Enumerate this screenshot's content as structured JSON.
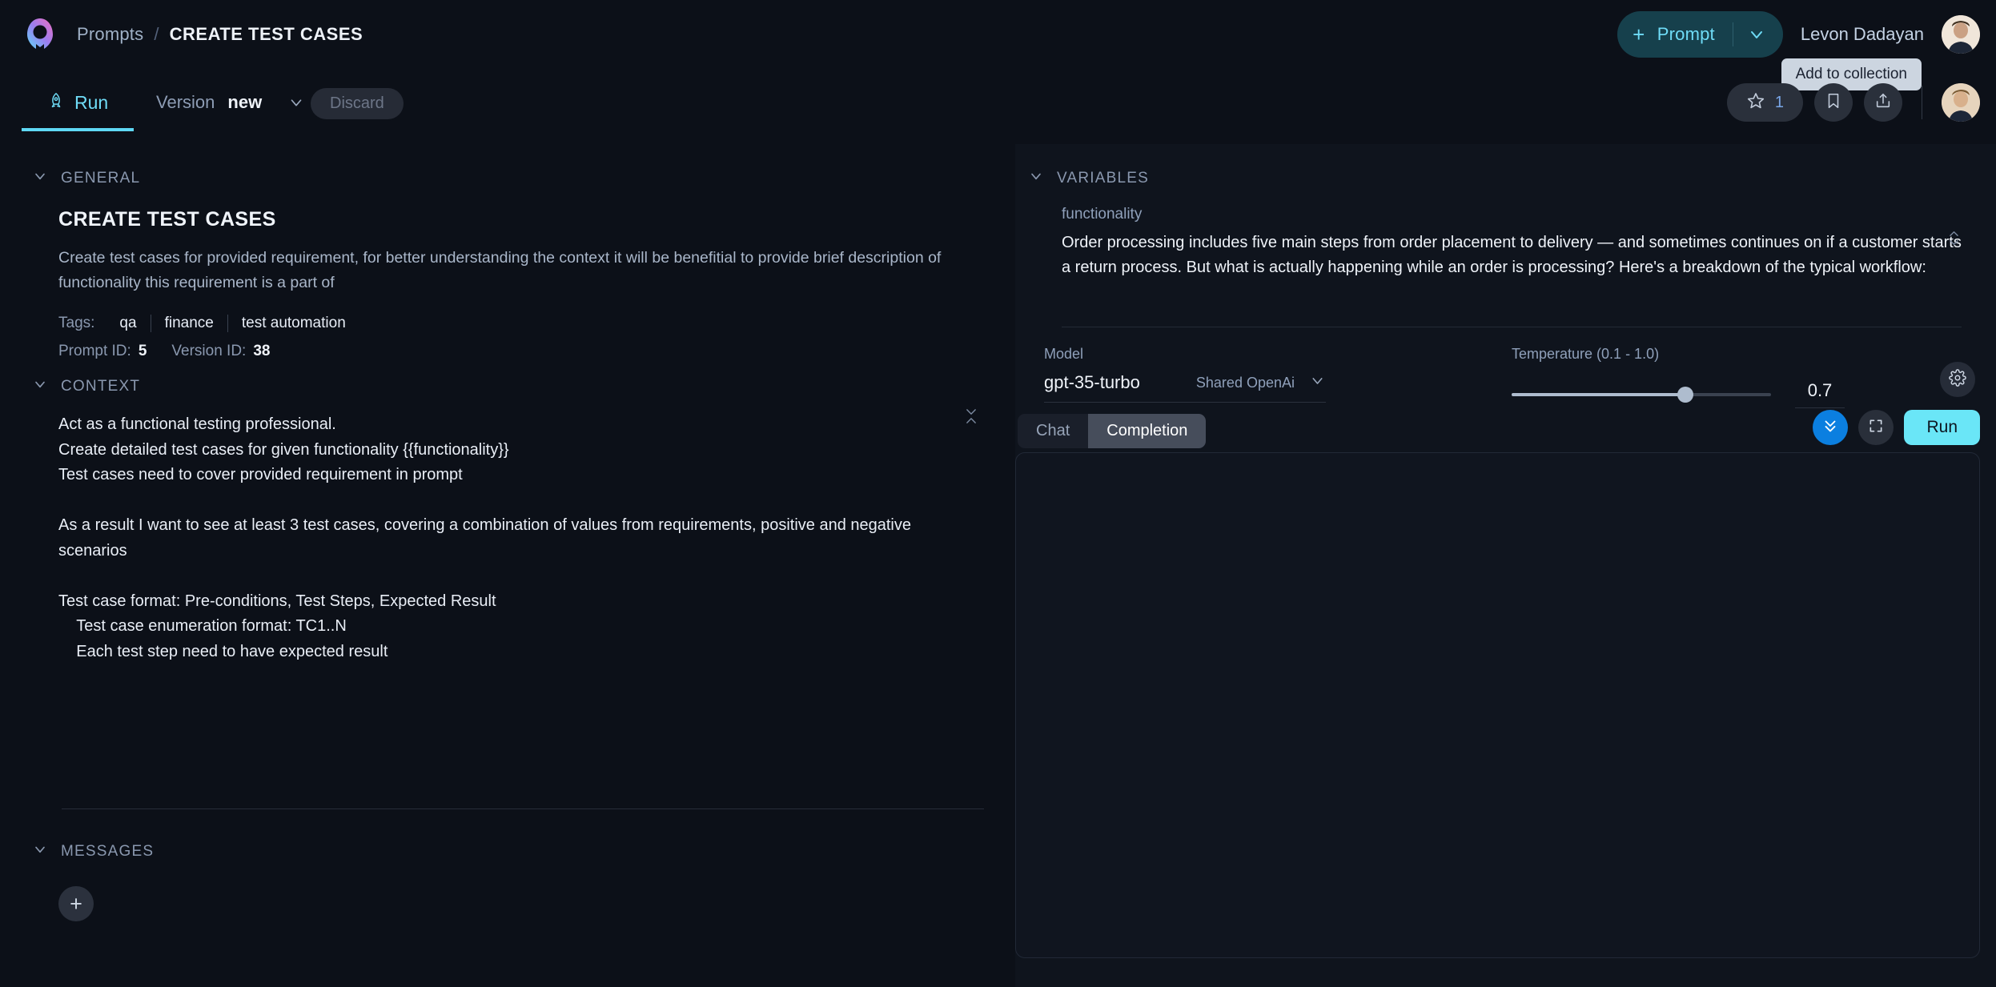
{
  "brand": {
    "logo_icon": "rocket-logo-icon"
  },
  "breadcrumb": {
    "root": "Prompts",
    "separator": "/",
    "current": "CREATE TEST CASES"
  },
  "header": {
    "prompt_button": {
      "plus": "+",
      "label": "Prompt",
      "chevron_icon": "chevron-down-icon"
    },
    "username": "Levon Dadayan",
    "avatar_icon": "user-avatar",
    "tooltip": "Add to collection"
  },
  "tabs": {
    "run": {
      "label": "Run",
      "icon": "rocket-icon"
    },
    "version": {
      "label": "Version",
      "value": "new",
      "chevron_icon": "chevron-down-icon"
    },
    "discard": {
      "label": "Discard"
    }
  },
  "actions": {
    "star": {
      "icon": "star-icon",
      "count": "1"
    },
    "bookmark": {
      "icon": "bookmark-icon"
    },
    "share": {
      "icon": "share-icon"
    },
    "avatar_icon": "user-avatar-small"
  },
  "general": {
    "section_label": "GENERAL",
    "title": "CREATE TEST CASES",
    "description": "Create test cases for provided requirement, for better understanding the context it will be benefitial to provide brief description of functionality this requirement is a part of",
    "tags_label": "Tags:",
    "tags": [
      "qa",
      "finance",
      "test automation"
    ],
    "prompt_id_label": "Prompt ID:",
    "prompt_id": "5",
    "version_id_label": "Version ID:",
    "version_id": "38"
  },
  "context": {
    "section_label": "CONTEXT",
    "body": "Act as a functional testing professional.\nCreate detailed test cases for given functionality {{functionality}}\nTest cases need to cover provided requirement in prompt\n\nAs a result I want to see at least 3 test cases, covering a combination of values from requirements, positive and negative scenarios\n\nTest case format: Pre-conditions, Test Steps, Expected Result\n    Test case enumeration format: TC1..N\n    Each test step need to have expected result",
    "resize_icon": "resize-vertical-icon"
  },
  "messages": {
    "section_label": "MESSAGES",
    "add_button": "+"
  },
  "variables": {
    "section_label": "VARIABLES",
    "name": "functionality",
    "value": "Order processing includes five main steps from order placement to delivery — and sometimes continues on if a customer starts a return process. But what is actually happening while an order is processing? Here's a breakdown of the typical workflow:",
    "resize_icon": "resize-vertical-icon"
  },
  "model": {
    "label": "Model",
    "name": "gpt-35-turbo",
    "vendor": "Shared OpenAi",
    "chevron_icon": "chevron-down-icon"
  },
  "temperature": {
    "label": "Temperature (0.1 - 1.0)",
    "value": "0.7",
    "min": 0.1,
    "max": 1.0,
    "percent": 67,
    "settings_icon": "gear-icon"
  },
  "output": {
    "mode_tabs": [
      {
        "label": "Chat",
        "active": false
      },
      {
        "label": "Completion",
        "active": true
      }
    ],
    "collapse_icon": "chevrons-down-icon",
    "fullscreen_icon": "fullscreen-icon",
    "run_label": "Run",
    "content": ""
  },
  "colors": {
    "accent_cyan": "#6fdcf7",
    "accent_blue": "#0b7fe0",
    "run_button": "#6ae6f7",
    "page_bg": "#0c1018",
    "panel_bg": "#0f141d"
  }
}
